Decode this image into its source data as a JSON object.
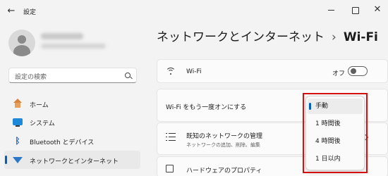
{
  "app": {
    "title": "設定"
  },
  "window": {
    "back": "←",
    "close": "✕"
  },
  "search": {
    "placeholder": "設定の検索"
  },
  "sidebar": {
    "items": [
      {
        "label": "ホーム",
        "icon": "home-icon",
        "selected": false
      },
      {
        "label": "システム",
        "icon": "system-icon",
        "selected": false
      },
      {
        "label": "Bluetooth とデバイス",
        "icon": "bluetooth-icon",
        "selected": false
      },
      {
        "label": "ネットワークとインターネット",
        "icon": "network-icon",
        "selected": true
      }
    ]
  },
  "breadcrumb": {
    "parent": "ネットワークとインターネット",
    "separator": "›",
    "current": "Wi-Fi"
  },
  "wifi_card": {
    "label": "Wi-Fi",
    "toggle_state": "オフ"
  },
  "retry_card": {
    "label": "Wi-Fi をもう一度オンにする"
  },
  "known_networks_card": {
    "label": "既知のネットワークの管理",
    "sub": "ネットワークの追加、削除、編集"
  },
  "hardware_card": {
    "label": "ハードウェアのプロパティ"
  },
  "dropdown": {
    "options": [
      "手動",
      "1 時間後",
      "4 時間後",
      "1 日以内"
    ],
    "selected_index": 0
  },
  "colors": {
    "accent": "#005fb8",
    "highlight": "#d60f0f"
  }
}
